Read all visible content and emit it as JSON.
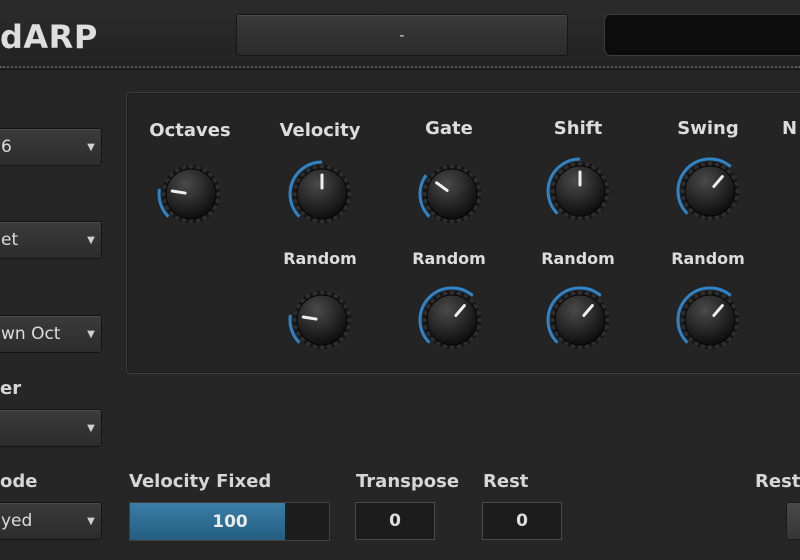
{
  "header": {
    "title": "dARP",
    "preset": "-"
  },
  "left": {
    "combos": [
      {
        "label": "",
        "value": "6"
      },
      {
        "label": "",
        "value": "et"
      },
      {
        "label": "",
        "value": "wn Oct"
      },
      {
        "label": "er",
        "value": ""
      },
      {
        "label": "ode",
        "value": "yed"
      }
    ],
    "arrow": "▼"
  },
  "knobs": {
    "top": [
      {
        "label": "Octaves",
        "value": 0.2
      },
      {
        "label": "Velocity",
        "value": 0.5
      },
      {
        "label": "Gate",
        "value": 0.3
      },
      {
        "label": "Shift",
        "value": 0.5
      },
      {
        "label": "Swing",
        "value": 0.65
      },
      {
        "label": "N"
      }
    ],
    "random": [
      {
        "label": "Random",
        "value": 0.2
      },
      {
        "label": "Random",
        "value": 0.65
      },
      {
        "label": "Random",
        "value": 0.65
      },
      {
        "label": "Random",
        "value": 0.65
      }
    ],
    "accent_color": "#2f84c8"
  },
  "bottom": {
    "velocity_fixed": {
      "label": "Velocity Fixed",
      "value": "100",
      "level": 0.78
    },
    "transpose": {
      "label": "Transpose",
      "value": "0"
    },
    "rest": {
      "label": "Rest",
      "value": "0"
    },
    "restart": {
      "label": "Resta"
    }
  }
}
